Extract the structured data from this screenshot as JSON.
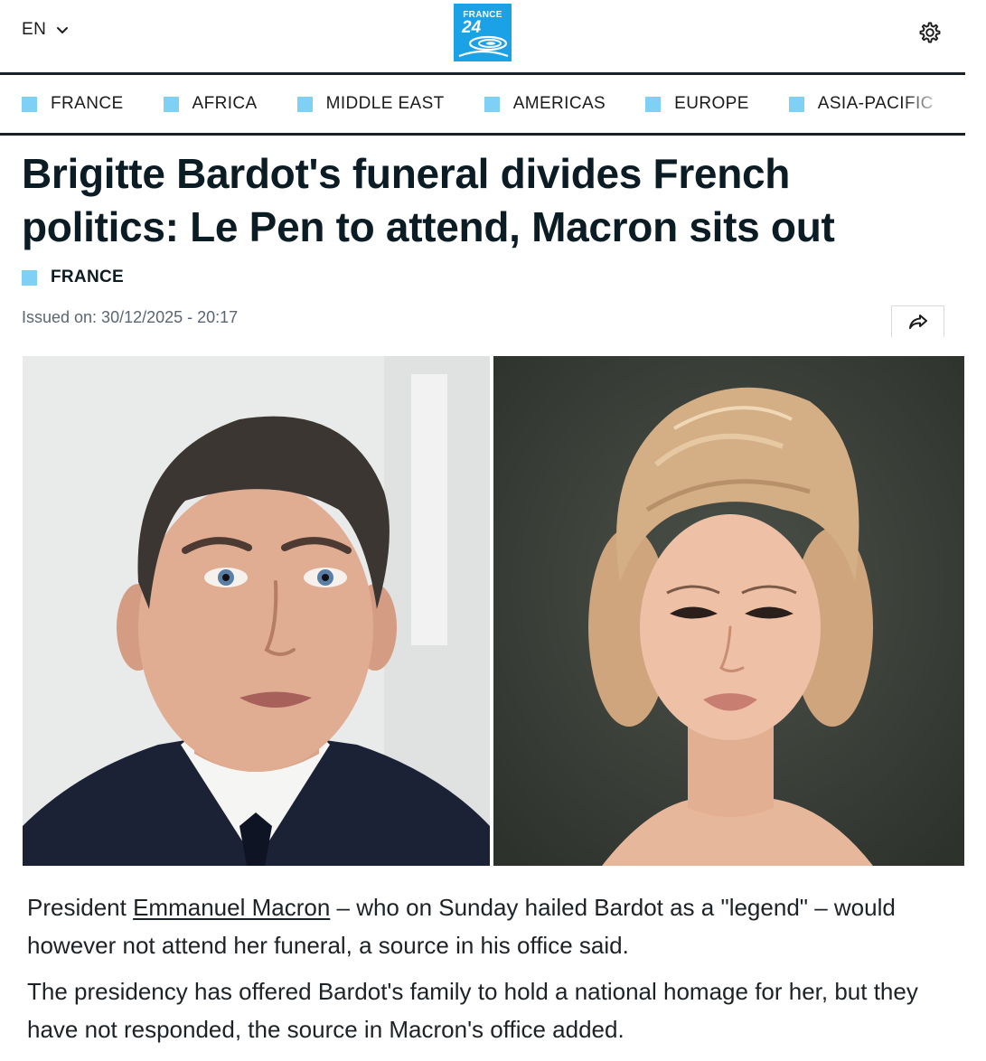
{
  "header": {
    "language": "EN",
    "logo": {
      "line1": "FRANCE",
      "line2": "24"
    },
    "settings_icon": "gear-icon"
  },
  "nav": {
    "items": [
      {
        "label": "FRANCE"
      },
      {
        "label": "AFRICA"
      },
      {
        "label": "MIDDLE EAST"
      },
      {
        "label": "AMERICAS"
      },
      {
        "label": "EUROPE"
      },
      {
        "label": "ASIA-PACIFIC"
      }
    ],
    "square_color": "#7fd0f5"
  },
  "article": {
    "headline": "Brigitte Bardot's funeral divides French politics: Le Pen to attend, Macron sits out",
    "category": "FRANCE",
    "issued": "Issued on: 30/12/2025 - 20:17",
    "share_icon": "share-arrow-icon",
    "paragraph1": {
      "before": "President ",
      "link": "Emmanuel Macron",
      "after": " – who on Sunday hailed Bardot as a \"legend\" – would however not attend her funeral, a source in his office said."
    },
    "paragraph2": "The presidency has offered Bardot's family to hold a national homage for her, but they have not responded, the source in Macron's office added."
  },
  "colors": {
    "brand_blue": "#1aa1e6",
    "accent_square": "#7fd0f5",
    "text_dark": "#0b1c24",
    "meta_gray": "#5b6670"
  }
}
